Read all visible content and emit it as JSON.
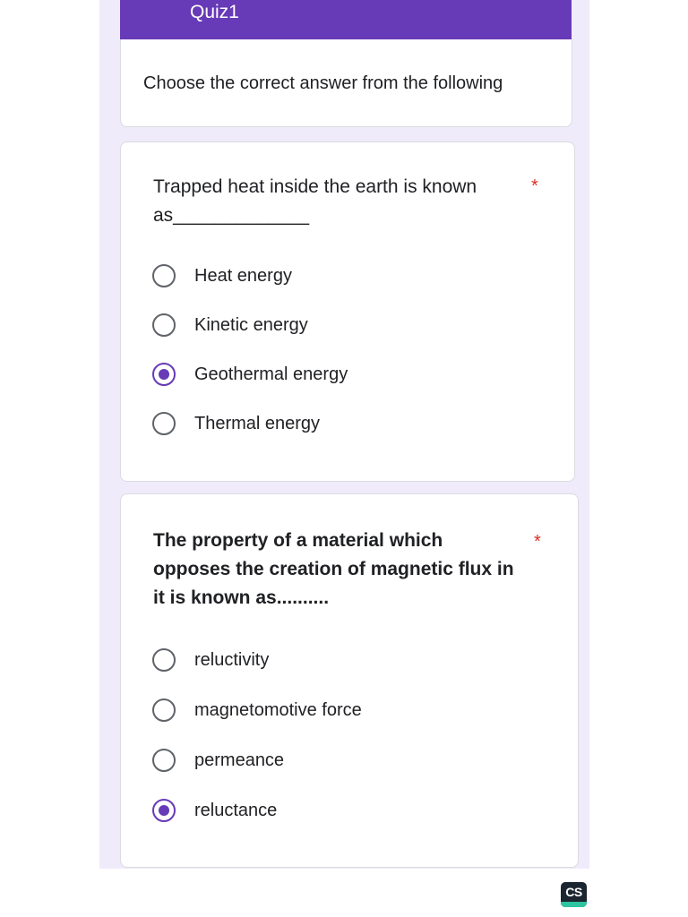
{
  "form": {
    "title": "Quiz1",
    "description": "Choose the correct answer from the following",
    "accent_color": "#673ab7",
    "background_color": "#efebfa",
    "required_mark": "*"
  },
  "questions": [
    {
      "text": "Trapped heat inside the earth is known as_____________",
      "required": true,
      "options": [
        {
          "label": "Heat energy",
          "selected": false
        },
        {
          "label": "Kinetic energy",
          "selected": false
        },
        {
          "label": "Geothermal energy",
          "selected": true
        },
        {
          "label": "Thermal energy",
          "selected": false
        }
      ]
    },
    {
      "text": "The property of a material which opposes the creation of magnetic flux in it is known as..........",
      "required": true,
      "options": [
        {
          "label": "reluctivity",
          "selected": false
        },
        {
          "label": "magnetomotive force",
          "selected": false
        },
        {
          "label": "permeance",
          "selected": false
        },
        {
          "label": "reluctance",
          "selected": true
        }
      ]
    }
  ],
  "watermark": {
    "text": "CS",
    "icon": "camscanner-logo-icon"
  }
}
